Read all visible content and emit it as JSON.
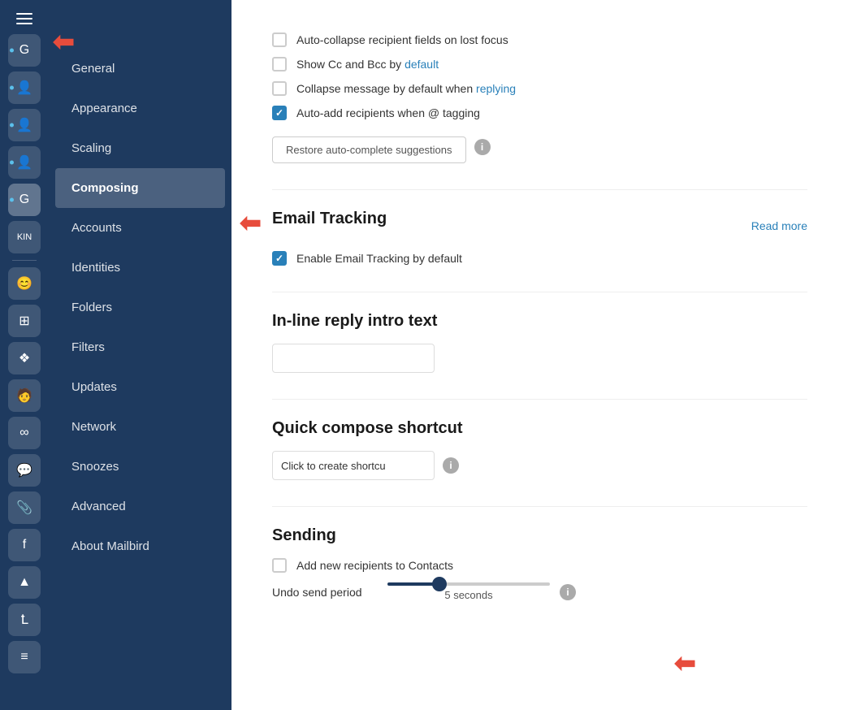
{
  "sidebar": {
    "items": [
      {
        "id": "general",
        "label": "General",
        "active": false
      },
      {
        "id": "appearance",
        "label": "Appearance",
        "active": false
      },
      {
        "id": "scaling",
        "label": "Scaling",
        "active": false
      },
      {
        "id": "composing",
        "label": "Composing",
        "active": true
      },
      {
        "id": "accounts",
        "label": "Accounts",
        "active": false
      },
      {
        "id": "identities",
        "label": "Identities",
        "active": false
      },
      {
        "id": "folders",
        "label": "Folders",
        "active": false
      },
      {
        "id": "filters",
        "label": "Filters",
        "active": false
      },
      {
        "id": "updates",
        "label": "Updates",
        "active": false
      },
      {
        "id": "network",
        "label": "Network",
        "active": false
      },
      {
        "id": "snoozes",
        "label": "Snoozes",
        "active": false
      },
      {
        "id": "advanced",
        "label": "Advanced",
        "active": false
      },
      {
        "id": "about",
        "label": "About Mailbird",
        "active": false
      }
    ]
  },
  "content": {
    "checkboxes": {
      "auto_collapse": {
        "label": "Auto-collapse recipient fields on lost focus",
        "checked": false
      },
      "show_cc_bcc": {
        "label": "Show Cc and Bcc by default",
        "checked": false
      },
      "collapse_message": {
        "label": "Collapse message by default when replying",
        "checked": false
      },
      "auto_add": {
        "label": "Auto-add recipients when @ tagging",
        "checked": true
      }
    },
    "restore_btn_label": "Restore auto-complete suggestions",
    "email_tracking": {
      "title": "Email Tracking",
      "checkbox_label": "Enable Email Tracking by default",
      "checked": true,
      "read_more": "Read more"
    },
    "inline_reply": {
      "title": "In-line reply intro text",
      "placeholder": ""
    },
    "quick_compose": {
      "title": "Quick compose shortcut",
      "value": "Click to create shortcu"
    },
    "sending": {
      "title": "Sending",
      "add_recipients_label": "Add new recipients to Contacts",
      "add_recipients_checked": false,
      "undo_send_label": "Undo send period",
      "undo_send_value": "5 seconds",
      "slider_value": 30
    }
  }
}
